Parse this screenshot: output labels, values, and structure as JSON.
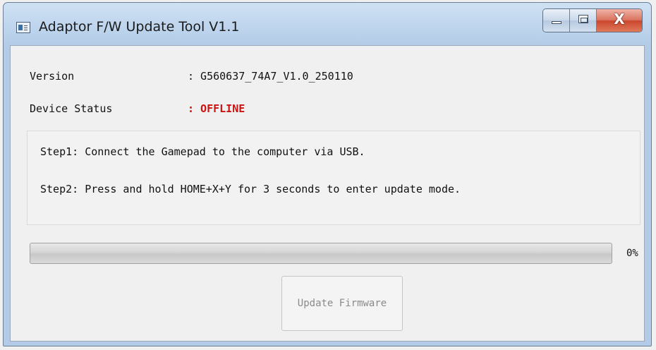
{
  "window": {
    "title": "Adaptor F/W Update Tool V1.1",
    "icon": "app-window-icon",
    "controls": {
      "minimize": "minimize-icon",
      "maximize": "maximize-icon",
      "close_glyph": "X"
    }
  },
  "info": {
    "version_label": "Version",
    "version_value": ": G560637_74A7_V1.0_250110",
    "status_label": "Device Status",
    "status_value": ": OFFLINE",
    "status_color": "#cc1111"
  },
  "steps": [
    "Step1: Connect the Gamepad to the computer via USB.",
    "Step2: Press and hold HOME+X+Y for 3 seconds to enter update mode."
  ],
  "progress": {
    "fraction": 0,
    "label": "0%"
  },
  "actions": {
    "update_label": "Update Firmware",
    "update_enabled": false
  }
}
